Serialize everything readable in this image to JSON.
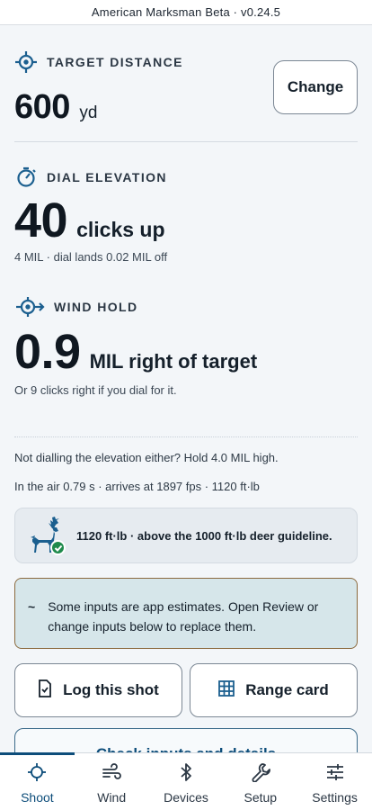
{
  "window": {
    "title": "American Marksman Beta · v0.24.5"
  },
  "distance": {
    "label": "TARGET DISTANCE",
    "value": "600",
    "unit": "yd",
    "change_label": "Change"
  },
  "elevation": {
    "label": "DIAL ELEVATION",
    "value": "40",
    "unit": "clicks up",
    "detail": "4 MIL · dial lands 0.02 MIL off"
  },
  "wind": {
    "label": "WIND HOLD",
    "value": "0.9",
    "unit": "MIL right of target",
    "detail": "Or 9 clicks right if you dial for it."
  },
  "notes": {
    "hold_note": "Not dialling the elevation either? Hold 4.0 MIL high.",
    "flight_note": "In the air 0.79 s · arrives at 1897 fps · 1120 ft·lb"
  },
  "energy": {
    "text": "1120 ft·lb · above the 1000 ft·lb deer guideline."
  },
  "estimate": {
    "marker": "~",
    "text": "Some inputs are app estimates. Open Review or change inputs below to replace them."
  },
  "actions": {
    "log_label": "Log this shot",
    "range_card_label": "Range card",
    "check_label": "Check inputs and details"
  },
  "tabs": [
    {
      "label": "Shoot",
      "icon": "crosshair-icon",
      "active": true
    },
    {
      "label": "Wind",
      "icon": "wind-icon",
      "active": false
    },
    {
      "label": "Devices",
      "icon": "bluetooth-icon",
      "active": false
    },
    {
      "label": "Setup",
      "icon": "wrench-icon",
      "active": false
    },
    {
      "label": "Settings",
      "icon": "sliders-icon",
      "active": false
    }
  ],
  "colors": {
    "accent": "#0d4d7a",
    "icon_blue": "#1b5f8f",
    "success": "#1f8a4c",
    "estimate_bg": "#d6e6ea",
    "estimate_border": "#8b6a3e"
  }
}
